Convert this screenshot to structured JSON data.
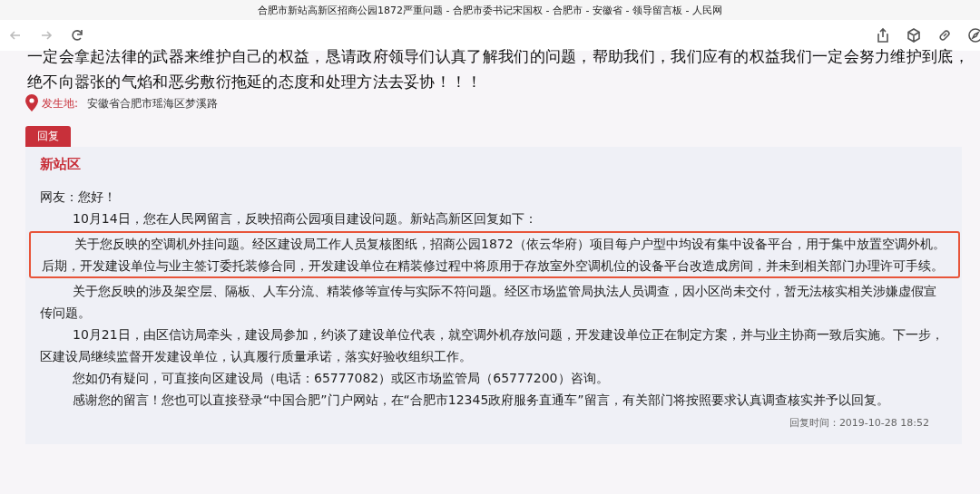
{
  "window": {
    "title": "合肥市新站高新区招商公园1872严重问题 - 合肥市委书记宋国权 - 合肥市 - 安徽省 - 领导留言板 - 人民网"
  },
  "message_tail": "一定会拿起法律的武器来维护自己的权益，恳请政府领导们认真了解我们的问题，帮助我们，我们应有的权益我们一定会努力维护到底，绝不向嚣张的气焰和恶劣敷衍拖延的态度和处理方法去妥协！！！",
  "location": {
    "label": "发生地:",
    "value": "安徽省合肥市瑶海区梦溪路"
  },
  "reply": {
    "tag": "回复",
    "department": "新站区",
    "paragraphs": [
      {
        "kind": "greeting",
        "highlighted": false,
        "text": "网友：您好！"
      },
      {
        "kind": "body",
        "highlighted": false,
        "text": "10月14日，您在人民网留言，反映招商公园项目建设问题。新站高新区回复如下："
      },
      {
        "kind": "body",
        "highlighted": true,
        "text": "关于您反映的空调机外挂问题。经区建设局工作人员复核图纸，招商公园1872（依云华府）项目每户户型中均设有集中设备平台，用于集中放置空调外机。后期，开发建设单位与业主签订委托装修合同，开发建设单位在精装修过程中将原用于存放室外空调机位的设备平台改造成房间，并未到相关部门办理许可手续。"
      },
      {
        "kind": "body",
        "highlighted": false,
        "text": "关于您反映的涉及架空层、隔板、人车分流、精装修等宣传与实际不符问题。经区市场监管局执法人员调查，因小区尚未交付，暂无法核实相关涉嫌虚假宣传问题。"
      },
      {
        "kind": "body",
        "highlighted": false,
        "text": "10月21日，由区信访局牵头，建设局参加，约谈了建设单位代表，就空调外机存放问题，开发建设单位正在制定方案，并与业主协商一致后实施。下一步，区建设局继续监督开发建设单位，认真履行质量承诺，落实好验收组织工作。"
      },
      {
        "kind": "body",
        "highlighted": false,
        "text": "您如仍有疑问，可直接向区建设局（电话：65777082）或区市场监管局（65777200）咨询。"
      },
      {
        "kind": "body",
        "highlighted": false,
        "text": "感谢您的留言！您也可以直接登录“中国合肥”门户网站，在“合肥市12345政府服务直通车”留言，有关部门将按照要求认真调查核实并予以回复。"
      }
    ],
    "reply_time": "回复时间：2019-10-28 18:52"
  }
}
